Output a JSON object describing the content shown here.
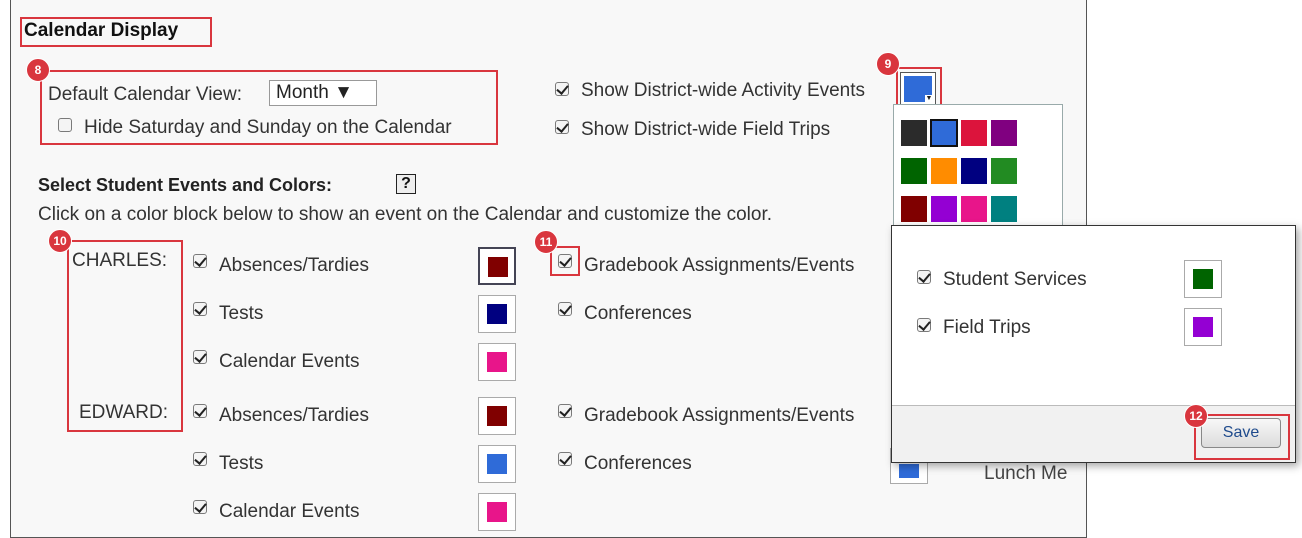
{
  "section_title": "Calendar Display",
  "default_view": {
    "label": "Default Calendar View:",
    "value": "Month ▼"
  },
  "hide_weekend": {
    "label": "Hide Saturday and Sunday on the Calendar",
    "checked": false
  },
  "district_activity": {
    "label": "Show District-wide Activity Events",
    "checked": true,
    "color": "#2f6bd8"
  },
  "district_trips": {
    "label": "Show District-wide Field Trips",
    "checked": true
  },
  "student_events": {
    "heading": "Select Student Events and Colors:",
    "help_glyph": "?",
    "instructions": "Click on a color block below to show an event on the Calendar and customize the color."
  },
  "students": [
    {
      "name": "CHARLES:",
      "left_events": [
        {
          "label": "Absences/Tardies",
          "color": "#800000"
        },
        {
          "label": "Tests",
          "color": "#000080"
        },
        {
          "label": "Calendar Events",
          "color": "#e8158a"
        }
      ],
      "right_events": [
        {
          "label": "Gradebook Assignments/Events"
        },
        {
          "label": "Conferences"
        }
      ]
    },
    {
      "name": "EDWARD:",
      "left_events": [
        {
          "label": "Absences/Tardies",
          "color": "#800000"
        },
        {
          "label": "Tests",
          "color": "#2f6bd8"
        },
        {
          "label": "Calendar Events",
          "color": "#e8158a"
        }
      ],
      "right_events": [
        {
          "label": "Gradebook Assignments/Events"
        },
        {
          "label": "Conferences"
        }
      ]
    }
  ],
  "cut_off_label": "Lunch Me",
  "palette_colors": [
    "#2b2b2b",
    "#2f6bd8",
    "#dc143c",
    "#800080",
    "#006400",
    "#ff8c00",
    "#000080",
    "#228b22",
    "#800000",
    "#9400d3",
    "#e8158a",
    "#008080"
  ],
  "popup": {
    "items": [
      {
        "label": "Student Services",
        "checked": true,
        "color": "#006400"
      },
      {
        "label": "Field Trips",
        "checked": true,
        "color": "#9400d3"
      }
    ],
    "save_label": "Save"
  },
  "badges": [
    "8",
    "9",
    "10",
    "11",
    "12"
  ]
}
